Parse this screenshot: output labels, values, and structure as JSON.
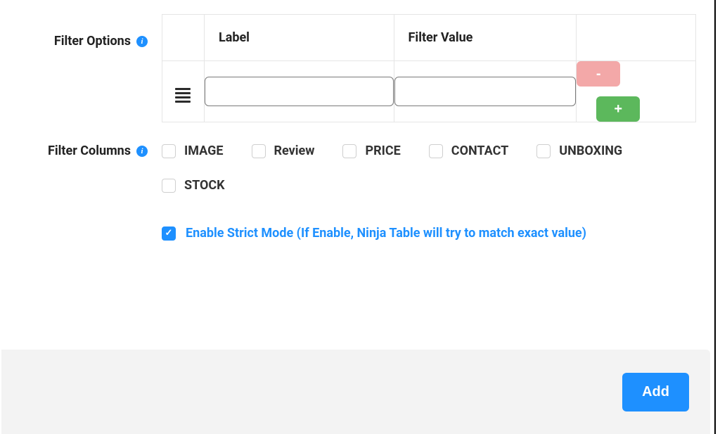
{
  "filterOptions": {
    "sectionLabel": "Filter Options",
    "headers": {
      "label": "Label",
      "filterValue": "Filter Value"
    },
    "rows": [
      {
        "label": "",
        "filterValue": ""
      }
    ],
    "buttons": {
      "remove": "-",
      "add": "+"
    }
  },
  "filterColumns": {
    "sectionLabel": "Filter Columns",
    "items": [
      {
        "label": "IMAGE",
        "checked": false
      },
      {
        "label": "Review",
        "checked": false
      },
      {
        "label": "PRICE",
        "checked": false
      },
      {
        "label": "CONTACT",
        "checked": false
      },
      {
        "label": "UNBOXING",
        "checked": false
      },
      {
        "label": "STOCK",
        "checked": false
      }
    ]
  },
  "strictMode": {
    "label": "Enable Strict Mode (If Enable, Ninja Table will try to match exact value)",
    "checked": true
  },
  "footer": {
    "addButton": "Add"
  }
}
